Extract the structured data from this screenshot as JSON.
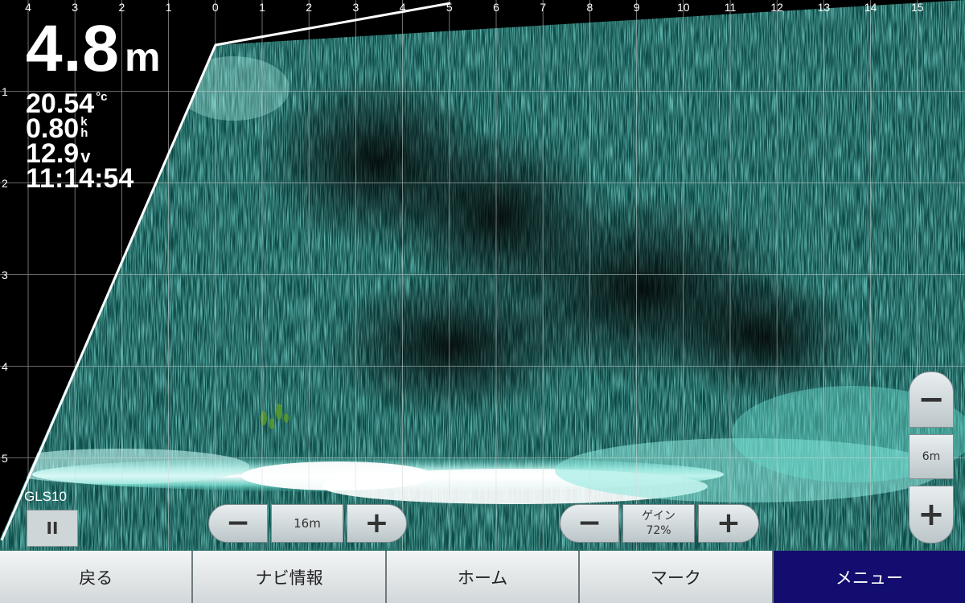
{
  "colors": {
    "sonar": "#3ec9bb",
    "bottom_echo": "#ffffff",
    "grid": "#d0d0d0",
    "active_nav": "#120d6e"
  },
  "axes": {
    "x_ticks": [
      "4",
      "3",
      "2",
      "1",
      "0",
      "1",
      "2",
      "3",
      "4",
      "5",
      "6",
      "7",
      "8",
      "9",
      "10",
      "11",
      "12",
      "13",
      "14",
      "15"
    ],
    "y_ticks": [
      "1",
      "2",
      "3",
      "4",
      "5"
    ]
  },
  "readouts": {
    "depth_value": "4.8",
    "depth_unit": "m",
    "water_temp": "20.54",
    "water_temp_unit": "°c",
    "speed": "0.80",
    "speed_unit_top": "k",
    "speed_unit_bottom": "h",
    "voltage": "12.9",
    "voltage_unit": "v",
    "time": "11:14:54"
  },
  "source": {
    "label": "GLS10",
    "pause_icon": "pause-icon",
    "pause_label": "II"
  },
  "range_control": {
    "value": "16m",
    "minus_icon": "minus-icon",
    "plus_icon": "plus-icon"
  },
  "gain_control": {
    "label": "ゲイン",
    "value": "72%",
    "minus_icon": "minus-icon",
    "plus_icon": "plus-icon"
  },
  "depth_control": {
    "value": "6m",
    "minus_icon": "minus-icon",
    "plus_icon": "plus-icon"
  },
  "nav": {
    "back": "戻る",
    "navi_info": "ナビ情報",
    "home": "ホーム",
    "mark": "マーク",
    "menu": "メニュー"
  }
}
